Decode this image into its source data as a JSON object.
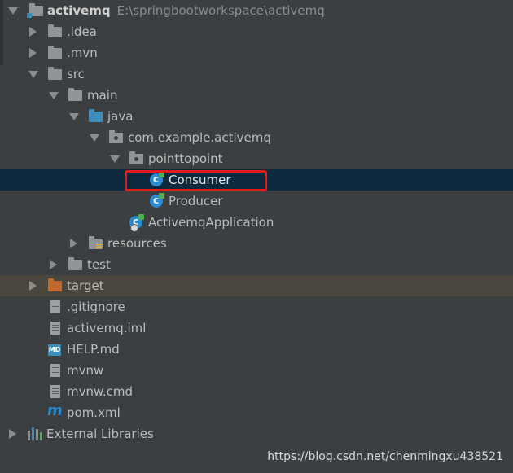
{
  "project": {
    "name": "activemq",
    "path": "E:\\springbootworkspace\\activemq"
  },
  "tree": {
    "idea": ".idea",
    "mvn": ".mvn",
    "src": "src",
    "main": "main",
    "java": "java",
    "package": "com.example.activemq",
    "subpackage": "pointtopoint",
    "consumer": "Consumer",
    "producer": "Producer",
    "application": "ActivemqApplication",
    "resources": "resources",
    "test": "test",
    "target": "target",
    "gitignore": ".gitignore",
    "iml": "activemq.iml",
    "help": "HELP.md",
    "mvnw": "mvnw",
    "mvnw_cmd": "mvnw.cmd",
    "pom": "pom.xml",
    "external_libraries": "External Libraries"
  },
  "icons": {
    "folder": "folder-icon",
    "source_folder": "source-folder-icon",
    "package": "package-icon",
    "class": "class-icon",
    "spring_boot_app": "spring-boot-application-icon",
    "excluded_folder": "excluded-folder-icon",
    "text_file": "file-icon",
    "markdown": "markdown-icon",
    "maven": "maven-icon",
    "libraries": "libraries-icon",
    "md_badge": "MD",
    "maven_glyph": "m"
  },
  "colors": {
    "background": "#3c3f41",
    "selection": "#0d293e",
    "excluded_row": "#4a453d",
    "source_folder": "#3d8dbb",
    "excluded_folder": "#c0692a",
    "highlight_box": "#e21b1b"
  },
  "watermark": "https://blog.csdn.net/chenmingxu438521"
}
